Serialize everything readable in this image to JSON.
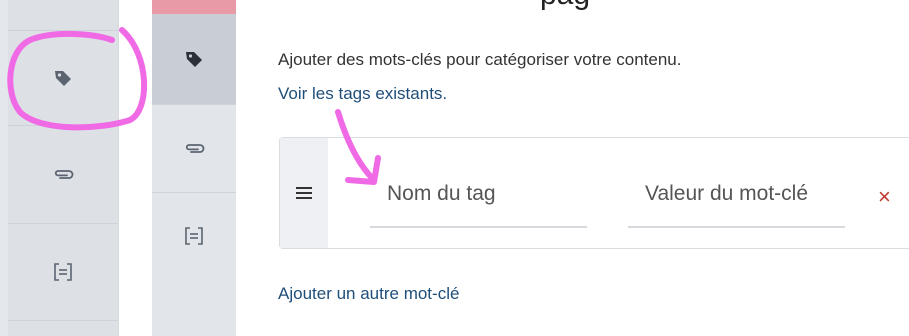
{
  "main": {
    "heading_fragment": "pag",
    "description": "Ajouter des mots-clés pour catégoriser votre contenu.",
    "view_tags_link": "Voir les tags existants.",
    "add_keyword_link": "Ajouter un autre mot-clé"
  },
  "tag_row": {
    "name_placeholder": "Nom du tag",
    "value_placeholder": "Valeur du mot-clé",
    "remove_symbol": "×"
  },
  "sidebar_left": {
    "items": [
      {
        "icon": "tag-icon",
        "active": true
      },
      {
        "icon": "paperclip-icon",
        "active": false
      },
      {
        "icon": "fields-icon",
        "active": false
      }
    ]
  },
  "sidebar_right": {
    "items": [
      {
        "icon": "tag-icon",
        "active": true
      },
      {
        "icon": "paperclip-icon",
        "active": false
      },
      {
        "icon": "fields-icon",
        "active": false
      }
    ]
  },
  "colors": {
    "link": "#1f4e79",
    "remove": "#c0392b",
    "annotation": "#f06ae6",
    "topbar_accent": "#e89aa6"
  }
}
